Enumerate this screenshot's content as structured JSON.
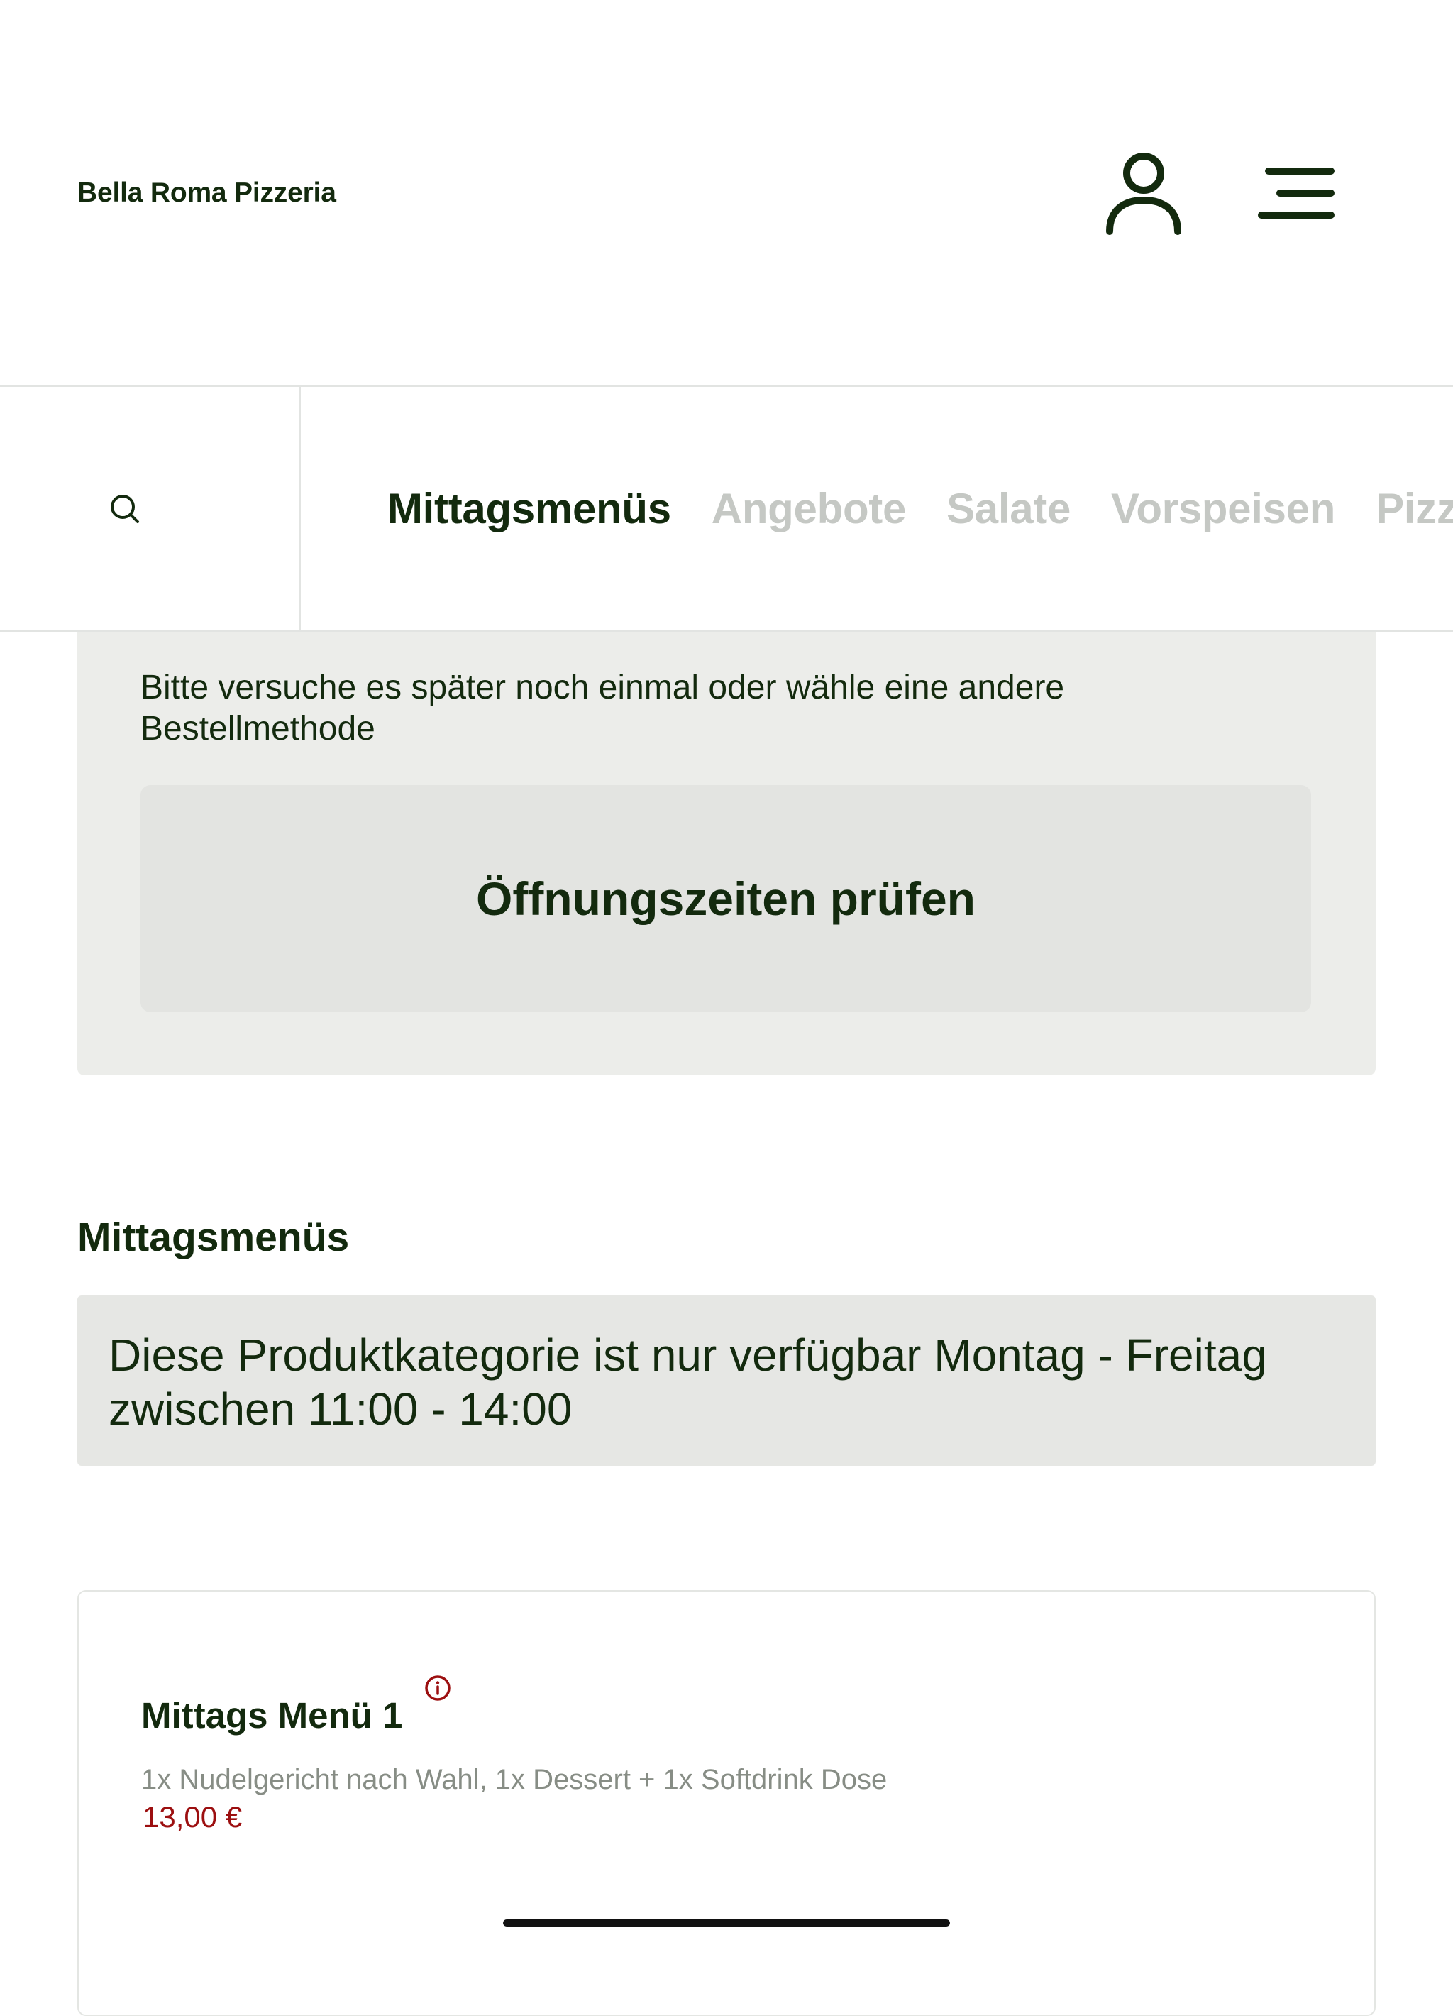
{
  "header": {
    "brand": "Bella Roma Pizzeria",
    "account_icon": "user-icon",
    "menu_icon": "hamburger-menu-icon"
  },
  "category_bar": {
    "search_icon": "search-icon",
    "tabs": [
      {
        "label": "Mittagsmenüs",
        "active": true
      },
      {
        "label": "Angebote",
        "active": false
      },
      {
        "label": "Salate",
        "active": false
      },
      {
        "label": "Vorspeisen",
        "active": false
      },
      {
        "label": "Pizza",
        "active": false
      }
    ]
  },
  "notice": {
    "message": "Bitte versuche es später noch einmal oder wähle eine andere Bestellmethode",
    "button_label": "Öffnungszeiten prüfen"
  },
  "section": {
    "title": "Mittagsmenüs",
    "availability": "Diese Produktkategorie ist nur verfügbar Montag - Freitag zwischen 11:00 - 14:00"
  },
  "products": [
    {
      "name": "Mittags Menü 1",
      "info_icon": "info-icon",
      "description": "1x Nudelgericht nach Wahl, 1x Dessert + 1x Softdrink Dose",
      "price": "13,00 €"
    }
  ],
  "colors": {
    "primary": "#132a0e",
    "inactive_tab": "#c5c8c4",
    "price": "#9c0f10",
    "card_bg": "#ecedea"
  }
}
